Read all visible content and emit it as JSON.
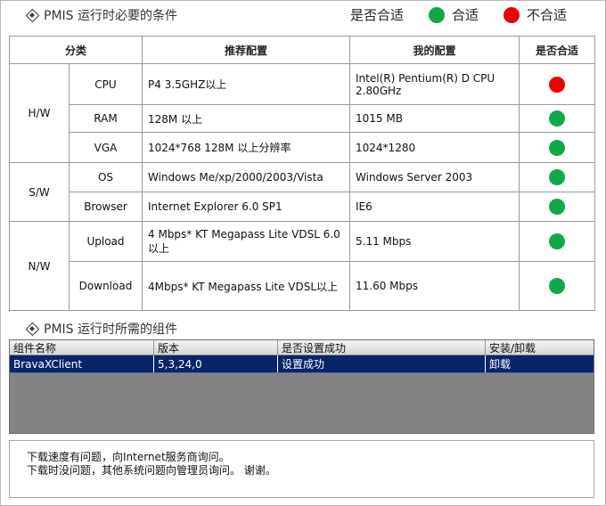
{
  "section1_title": "PMIS 运行时必要的条件",
  "legend": {
    "label": "是否合适",
    "ok_label": "合适",
    "bad_label": "不合适",
    "ok_color": "#11a84a",
    "bad_color": "#ee0000"
  },
  "req_table": {
    "headers": [
      "分类",
      "推荐配置",
      "我的配置",
      "是否合适"
    ],
    "groups": [
      {
        "category": "H/W",
        "rows": [
          {
            "item": "CPU",
            "recommended": "P4  3.5GHZ以上",
            "mine": "Intel(R) Pentium(R) D CPU 2.80GHz",
            "status": "bad"
          },
          {
            "item": "RAM",
            "recommended": "128M 以上",
            "mine": "1015 MB",
            "status": "ok"
          },
          {
            "item": "VGA",
            "recommended": "1024*768 128M 以上分辨率",
            "mine": "1024*1280",
            "status": "ok"
          }
        ]
      },
      {
        "category": "S/W",
        "rows": [
          {
            "item": "OS",
            "recommended": "Windows Me/xp/2000/2003/Vista",
            "mine": "Windows Server 2003",
            "status": "ok"
          },
          {
            "item": "Browser",
            "recommended": "Internet Explorer 6.0 SP1",
            "mine": "IE6",
            "status": "ok"
          }
        ]
      },
      {
        "category": "N/W",
        "rows": [
          {
            "item": "Upload",
            "recommended": "4 Mbps* KT Megapass Lite VDSL 6.0以上",
            "mine": "5.11 Mbps",
            "status": "ok"
          },
          {
            "item": "Download",
            "recommended": "4Mbps* KT Megapass Lite VDSL以上",
            "mine": "11.60 Mbps",
            "status": "ok"
          }
        ]
      }
    ]
  },
  "section2_title": "PMIS 运行时所需的组件",
  "components": {
    "headers": [
      "组件名称",
      "版本",
      "是否设置成功",
      "安装/卸载"
    ],
    "rows": [
      {
        "name": "BravaXClient",
        "version": "5,3,24,0",
        "status": "设置成功",
        "action": "卸载"
      }
    ]
  },
  "notice": [
    "下载速度有问题，向Internet服务商询问。",
    "下载时没问题，其他系统问题向管理员询问。 谢谢。"
  ]
}
